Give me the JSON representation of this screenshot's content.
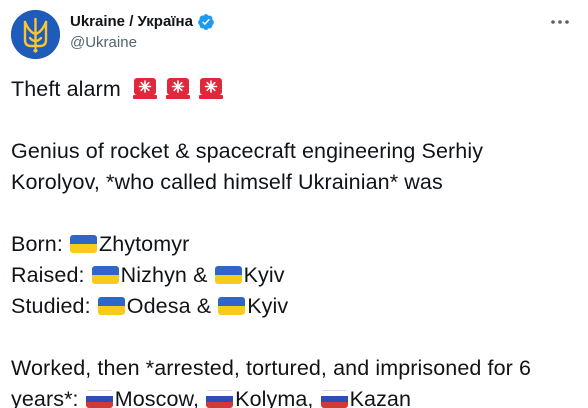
{
  "author": {
    "display_name": "Ukraine / Україна",
    "handle": "@Ukraine",
    "verified": true
  },
  "icons": {
    "avatar": "ukraine-trident-icon",
    "verified": "verified-badge-icon",
    "more": "more-options-icon",
    "siren": "police-car-light-icon",
    "flag_ua": "ukraine-flag-icon",
    "flag_ru": "russia-flag-icon"
  },
  "colors": {
    "text": "#0f1419",
    "secondary": "#536471",
    "verified": "#1d9bf0",
    "avatar_bg": "#1f5bb8",
    "trident": "#f7c531",
    "ua_blue": "#2f67c9",
    "ua_yellow": "#f6cb1b",
    "ru_white": "#ffffff",
    "ru_blue": "#2d4fb5",
    "ru_red": "#d23a3a",
    "siren_red": "#e0273b"
  },
  "post": {
    "line1": "Theft alarm",
    "line2": "Genius of rocket & spacecraft engineering Serhiy Korolyov, *who called himself Ukrainian* was",
    "born_label": "Born: ",
    "born_place": "Zhytomyr",
    "raised_label": "Raised: ",
    "raised_place1": "Nizhyn",
    "raised_sep": " & ",
    "raised_place2": "Kyiv",
    "studied_label": "Studied: ",
    "studied_place1": "Odesa",
    "studied_sep": " & ",
    "studied_place2": "Kyiv",
    "worked_text": "Worked, then *arrested, tortured, and imprisoned for 6 years*: ",
    "worked_place1": "Moscow",
    "worked_sep1": ", ",
    "worked_place2": "Kolyma",
    "worked_sep2": ", ",
    "worked_place3": "Kazan"
  }
}
